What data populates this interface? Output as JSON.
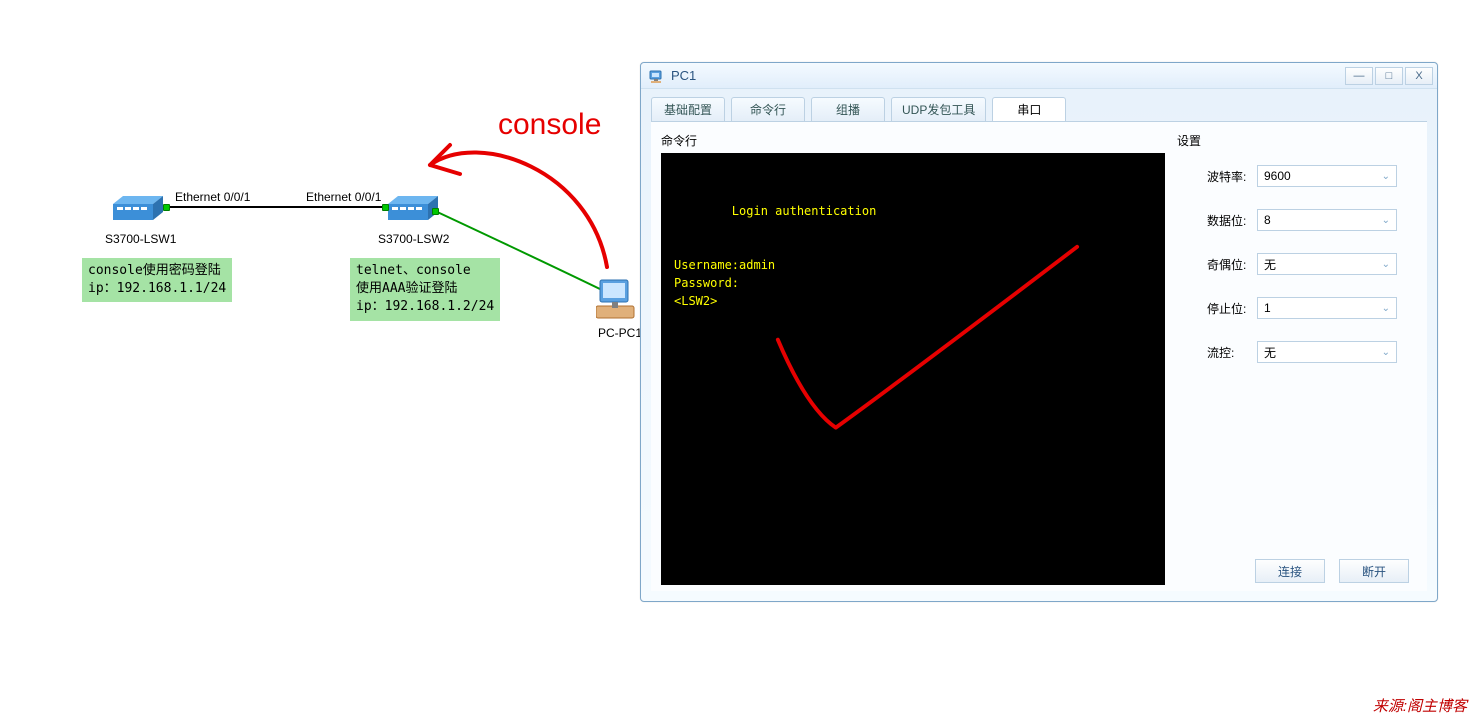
{
  "topology": {
    "switch1": {
      "label": "S3700-LSW1",
      "note": "console使用密码登陆\nip：192.168.1.1/24"
    },
    "switch2": {
      "label": "S3700-LSW2",
      "note": "telnet、console\n使用AAA验证登陆\nip：192.168.1.2/24"
    },
    "eth_label_1": "Ethernet 0/0/1",
    "eth_label_2": "Ethernet 0/0/1",
    "pc": {
      "label": "PC-PC1"
    },
    "console_label": "console"
  },
  "window": {
    "title": "PC1",
    "tabs": [
      "基础配置",
      "命令行",
      "组播",
      "UDP发包工具",
      "串口"
    ],
    "active_tab": 4,
    "left_header": "命令行",
    "right_header": "设置",
    "terminal_lines": "Login authentication\n\n\nUsername:admin\nPassword:\n<LSW2>",
    "settings": {
      "baud": {
        "label": "波特率:",
        "value": "9600"
      },
      "data": {
        "label": "数据位:",
        "value": "8"
      },
      "parity": {
        "label": "奇偶位:",
        "value": "无"
      },
      "stop": {
        "label": "停止位:",
        "value": "1"
      },
      "flow": {
        "label": "流控:",
        "value": "无"
      }
    },
    "buttons": {
      "connect": "连接",
      "disconnect": "断开"
    }
  },
  "attribution": "来源:阁主博客"
}
